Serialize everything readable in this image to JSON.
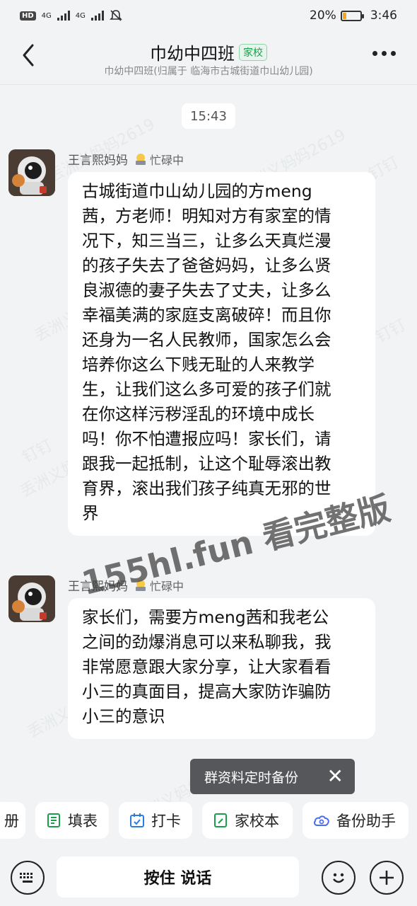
{
  "status_bar": {
    "hd_label": "HD",
    "sim1": "4G",
    "sim2": "4G",
    "battery_percent": "20%",
    "battery_level": 0.2,
    "time": "3:46"
  },
  "header": {
    "title": "巾幼中四班",
    "tag": "家校",
    "subtitle": "巾幼中四班(归属于 临海市古城街道巾山幼儿园)"
  },
  "time_divider": "15:43",
  "messages": [
    {
      "sender": "王言熙妈妈",
      "status": "忙碌中",
      "lines": [
        "古城街道巾山幼儿园的方meng",
        "茜，方老师！明知对方有家室的情",
        "况下，知三当三，让多么天真烂漫",
        "的孩子失去了爸爸妈妈，让多么贤",
        "良淑德的妻子失去了丈夫，让多么",
        "幸福美满的家庭支离破碎！而且你",
        "还身为一名人民教师，国家怎么会",
        "培养你这么下贱无耻的人来教学",
        "生，让我们这么多可爱的孩子们就",
        "在你这样污秽淫乱的环境中成长",
        "吗！你不怕遭报应吗！家长们，请",
        "跟我一起抵制，让这个耻辱滚出教",
        "育界，滚出我们孩子纯真无邪的世",
        "界"
      ]
    },
    {
      "sender": "王言熙妈妈",
      "status": "忙碌中",
      "lines": [
        "家长们，需要方meng茜和我老公",
        "之间的劲爆消息可以来私聊我，我",
        "非常愿意跟大家分享，让大家看看",
        "小三的真面目，提高大家防诈骗防",
        "小三的意识"
      ]
    }
  ],
  "overlay_text": "155hl.fun 看完整版",
  "watermark_text": "丢洲义妈妈2619",
  "watermark_app": "钉钉",
  "toast": {
    "text": "群资料定时备份",
    "close": "✕"
  },
  "toolbar": {
    "partial": "册",
    "form": "填表",
    "checkin": "打卡",
    "school_book": "家校本",
    "backup": "备份助手"
  },
  "input": {
    "voice_label": "按住 说话"
  }
}
